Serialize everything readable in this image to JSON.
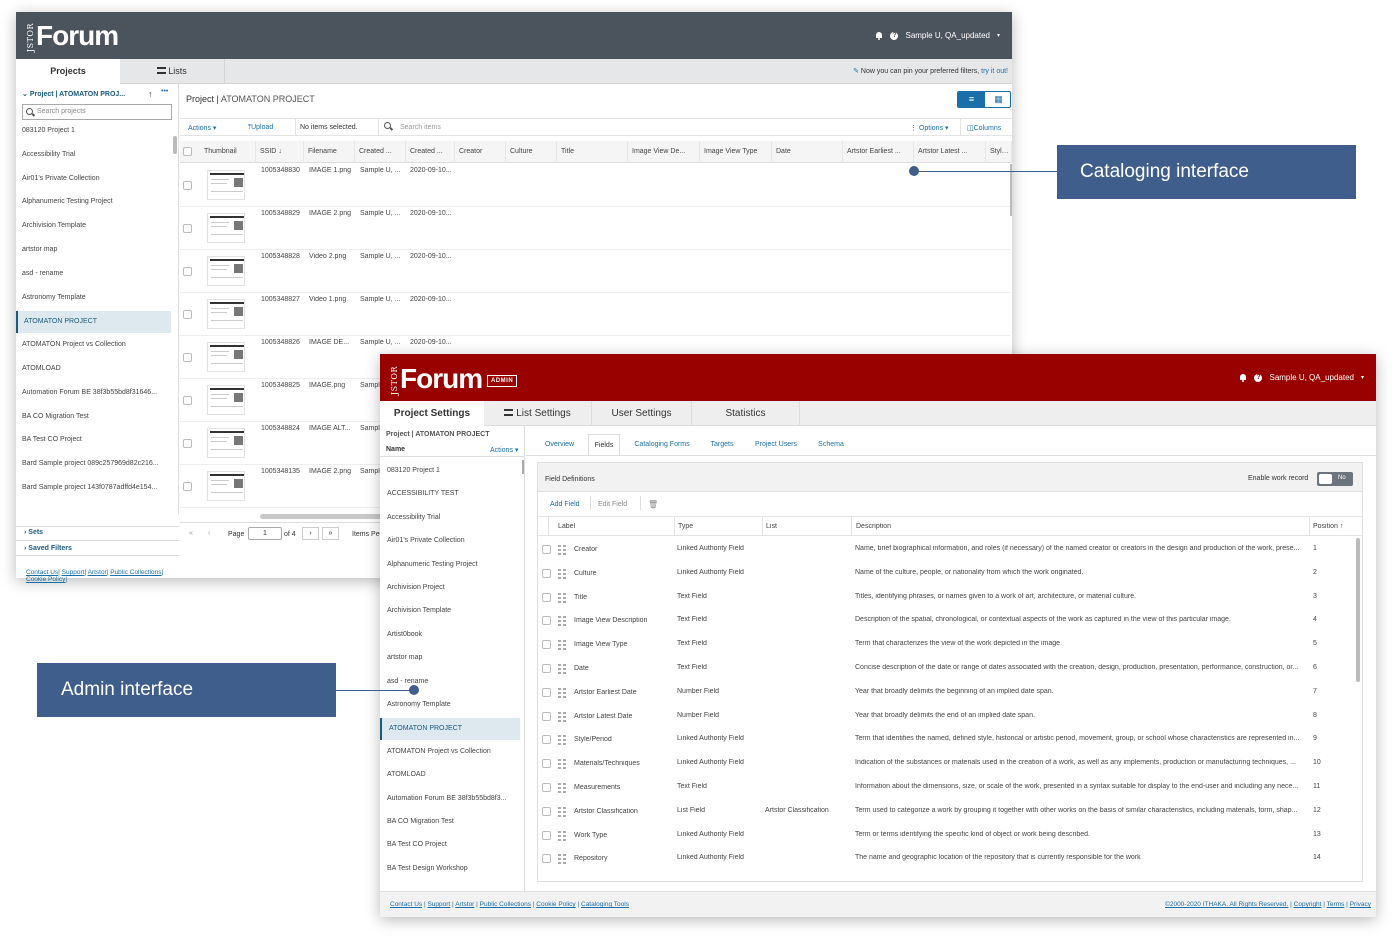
{
  "catalog": {
    "logo": {
      "jstor": "JSTOR",
      "word": "Forum"
    },
    "user": {
      "name": "Sample U, QA_updated",
      "caret": "▾"
    },
    "tabs": {
      "projects": "Projects",
      "lists": "Lists"
    },
    "pin_notice": {
      "text": "Now you can pin your preferred filters,",
      "link": "try it out!"
    },
    "project_header": {
      "label": "Project | ATOMATON PROJ...",
      "more": "•••"
    },
    "search_projects_placeholder": "Search projects",
    "projects": [
      "083120 Project 1",
      "Accessibility Trial",
      "Air01's Private Collection",
      "Alphanumeric Testing Project",
      "Archivision Template",
      "artstor map",
      "asd - rename",
      "Astronomy Template",
      "ATOMATON PROJECT",
      "ATOMATON Project vs Collection",
      "ATOMLOAD",
      "Automation Forum BE 38f3b55bd8f31646...",
      "BA CO Migration Test",
      "BA Test CO Project",
      "Bard Sample project 089c257969d82c216...",
      "Bard Sample project 143f0787adffd4e154..."
    ],
    "selected_project": "ATOMATON PROJECT",
    "sets_label": "Sets",
    "saved_filters_label": "Saved Filters",
    "footer_links": [
      "Contact Us",
      "Support",
      "Artstor",
      "Public Collections",
      "Cookie Policy"
    ],
    "title": {
      "prefix": "Project | ",
      "name": "ATOMATON PROJECT"
    },
    "toolbar": {
      "actions": "Actions",
      "upload": "Upload",
      "selection": "No items selected.",
      "search_placeholder": "Search items",
      "options": "Options",
      "columns": "Columns"
    },
    "columns": [
      "Thumbnail",
      "SSID",
      "Filename",
      "Created ...",
      "Created ...",
      "Creator",
      "Culture",
      "Title",
      "Image View De...",
      "Image View Type",
      "Date",
      "Artstor Earliest ...",
      "Artstor Latest ...",
      "Style/P"
    ],
    "rows": [
      {
        "ssid": "1005348830",
        "filename": "IMAGE 1.png",
        "created_by": "Sample U, ...",
        "created_on": "2020-09-10..."
      },
      {
        "ssid": "1005348829",
        "filename": "IMAGE 2.png",
        "created_by": "Sample U, ...",
        "created_on": "2020-09-10..."
      },
      {
        "ssid": "1005348828",
        "filename": "Video 2.png",
        "created_by": "Sample U, ...",
        "created_on": "2020-09-10..."
      },
      {
        "ssid": "1005348827",
        "filename": "Video 1.png",
        "created_by": "Sample U, ...",
        "created_on": "2020-09-10..."
      },
      {
        "ssid": "1005348826",
        "filename": "IMAGE DE...",
        "created_by": "Sample U, ...",
        "created_on": "2020-09-10..."
      },
      {
        "ssid": "1005348825",
        "filename": "IMAGE.png",
        "created_by": "Sampl",
        "created_on": ""
      },
      {
        "ssid": "1005348824",
        "filename": "IMAGE ALT...",
        "created_by": "Sampl",
        "created_on": ""
      },
      {
        "ssid": "1005348135",
        "filename": "IMAGE 2.png",
        "created_by": "Sampl",
        "created_on": ""
      }
    ],
    "pagination": {
      "first": "«",
      "prev": "‹",
      "page_label": "Page",
      "page": "1",
      "of": "of 4",
      "next": "›",
      "last": "»",
      "items": "Items Pe"
    }
  },
  "admin": {
    "logo": {
      "jstor": "JSTOR",
      "word": "Forum",
      "badge": "ADMIN"
    },
    "user": {
      "name": "Sample U, QA_updated",
      "caret": "▾"
    },
    "tabs": {
      "project_settings": "Project Settings",
      "list_settings": "List Settings",
      "user_settings": "User Settings",
      "statistics": "Statistics"
    },
    "project_header": "Project | ATOMATON PROJECT",
    "name_col": "Name",
    "actions": "Actions",
    "projects": [
      "083120 Project 1",
      "ACCESSIBILITY TEST",
      "Accessibility Trial",
      "Air01's Private Collection",
      "Alphanumeric Testing Project",
      "Archivision Project",
      "Archivision Template",
      "Artist0book",
      "artstor map",
      "asd - rename",
      "Astronomy Template",
      "ATOMATON PROJECT",
      "ATOMATON Project vs Collection",
      "ATOMLOAD",
      "Automation Forum BE 38f3b55bd8f3...",
      "BA CO Migration Test",
      "BA Test CO Project",
      "BA Test Design Workshop"
    ],
    "selected_project": "ATOMATON PROJECT",
    "subtabs": [
      "Overview",
      "Fields",
      "Cataloging Forms",
      "Targets",
      "Project Users",
      "Schema"
    ],
    "active_subtab": "Fields",
    "field_definitions": "Field Definitions",
    "enable_work_record": "Enable work record",
    "toggle": "No",
    "add_field": "Add Field",
    "edit_field": "Edit Field",
    "field_columns": {
      "label": "Label",
      "type": "Type",
      "list": "List",
      "description": "Description",
      "position": "Position"
    },
    "fields": [
      {
        "label": "Creator",
        "type": "Linked Authority Field",
        "list": "",
        "description": "Name, brief biographical information, and roles (if necessary) of the named creator or creators in the design and production of the work, prese...",
        "position": "1"
      },
      {
        "label": "Culture",
        "type": "Linked Authority Field",
        "list": "",
        "description": "Name of the culture, people, or nationality from which the work originated.",
        "position": "2"
      },
      {
        "label": "Title",
        "type": "Text Field",
        "list": "",
        "description": "Titles, identifying phrases, or names given to a work of art, architecture, or material culture.",
        "position": "3"
      },
      {
        "label": "Image View Description",
        "type": "Text Field",
        "list": "",
        "description": "Description of the spatial, chronological, or contextual aspects of the work as captured in the view of this particular image.",
        "position": "4"
      },
      {
        "label": "Image View Type",
        "type": "Text Field",
        "list": "",
        "description": "Term that characterizes the view of the work depicted in the image",
        "position": "5"
      },
      {
        "label": "Date",
        "type": "Text Field",
        "list": "",
        "description": "Concise description of the date or range of dates associated with the creation, design, production, presentation, performance, construction, or...",
        "position": "6"
      },
      {
        "label": "Artstor Earliest Date",
        "type": "Number Field",
        "list": "",
        "description": "Year that broadly delimits the beginning of an implied date span.",
        "position": "7"
      },
      {
        "label": "Artstor Latest Date",
        "type": "Number Field",
        "list": "",
        "description": "Year that broadly delimits the end of an implied date span.",
        "position": "8"
      },
      {
        "label": "Style/Period",
        "type": "Linked Authority Field",
        "list": "",
        "description": "Term that identifies the named, defined style, historical or artistic period, movement, group, or school whose characteristics are represented in...",
        "position": "9"
      },
      {
        "label": "Materials/Techniques",
        "type": "Linked Authority Field",
        "list": "",
        "description": "Indication of the substances or materials used in the creation of a work, as well as any implements, production or manufacturing techniques, ...",
        "position": "10"
      },
      {
        "label": "Measurements",
        "type": "Text Field",
        "list": "",
        "description": "Information about the dimensions, size, or scale of the work, presented in a syntax suitable for display to the end-user and including any nece...",
        "position": "11"
      },
      {
        "label": "Artstor Classification",
        "type": "List Field",
        "list": "Artstor Classification",
        "description": "Term used to categorize a work by grouping it together with other works on the basis of similar characteristics, including materials, form, shap...",
        "position": "12"
      },
      {
        "label": "Work Type",
        "type": "Linked Authority Field",
        "list": "",
        "description": "Term or terms identifying the specific kind of object or work being described.",
        "position": "13"
      },
      {
        "label": "Repository",
        "type": "Linked Authority Field",
        "list": "",
        "description": "The name and geographic location of the repository that is currently responsible for the work",
        "position": "14"
      }
    ],
    "footer_links": [
      "Contact Us",
      "Support",
      "Artstor",
      "Public Collections",
      "Cookie Policy",
      "Cataloging Tools"
    ],
    "footer_right": [
      "©2000-2020 ITHAKA. All Rights Reserved.",
      "Copyright",
      "Terms",
      "Privacy"
    ]
  },
  "callouts": {
    "cataloging": "Cataloging interface",
    "admin": "Admin interface"
  },
  "colors": {
    "catalog_header": "#4b535c",
    "admin_header": "#990000",
    "callout": "#3f5e8c",
    "link": "#1b6fa8",
    "selected_row": "#dde8ef"
  }
}
